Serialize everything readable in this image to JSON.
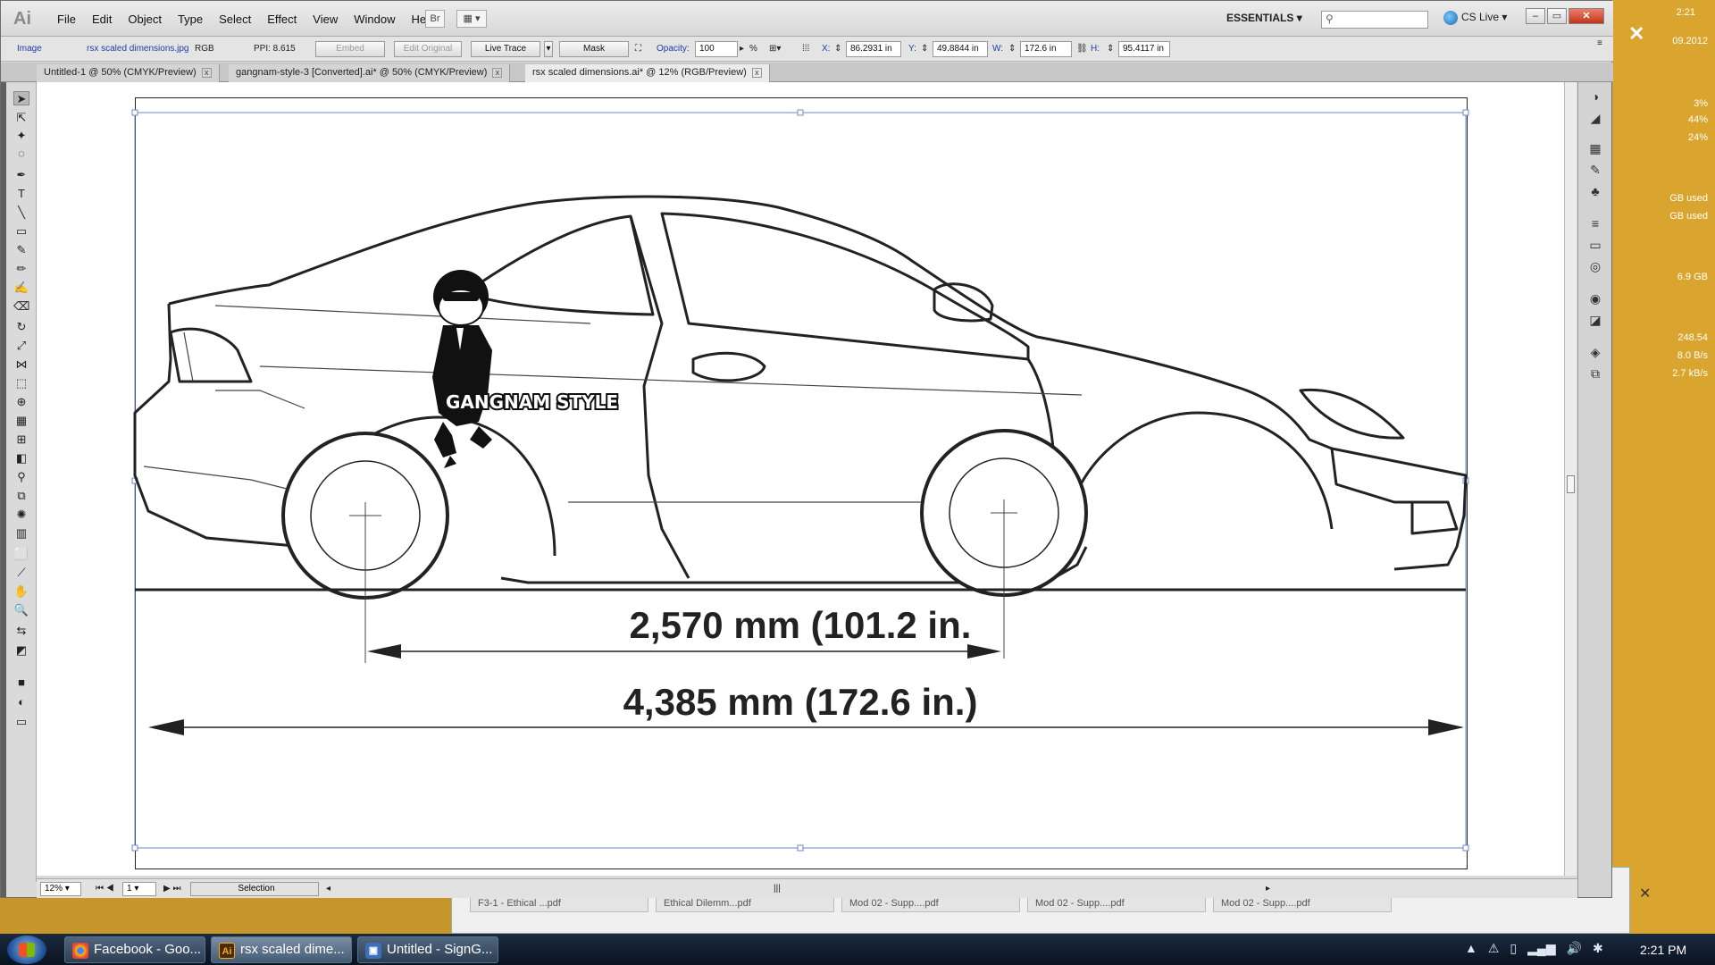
{
  "app": {
    "logo": "Ai",
    "menu": [
      "File",
      "Edit",
      "Object",
      "Type",
      "Select",
      "Effect",
      "View",
      "Window",
      "Help"
    ],
    "bridge_label": "Br",
    "workspace": "ESSENTIALS",
    "cs_live": "CS Live",
    "window_controls": [
      "–",
      "▭",
      "✕"
    ]
  },
  "control": {
    "type_label": "Image",
    "file_name": "rsx scaled dimensions.jpg",
    "color_mode": "RGB",
    "ppi": "PPI: 8.615",
    "embed": "Embed",
    "edit_original": "Edit Original",
    "live_trace": "Live Trace",
    "mask": "Mask",
    "opacity_label": "Opacity:",
    "opacity_value": "100",
    "opacity_unit": "%",
    "x_label": "X:",
    "x_value": "86.2931 in",
    "y_label": "Y:",
    "y_value": "49.8844 in",
    "w_label": "W:",
    "w_value": "172.6 in",
    "h_label": "H:",
    "h_value": "95.4117 in"
  },
  "tabs": [
    {
      "label": "Untitled-1 @ 50% (CMYK/Preview)"
    },
    {
      "label": "gangnam-style-3 [Converted].ai* @ 50% (CMYK/Preview)"
    },
    {
      "label": "rsx scaled dimensions.ai* @ 12% (RGB/Preview)"
    }
  ],
  "artwork": {
    "logo_text": "GANGNAM STYLE",
    "wheelbase": "2,570 mm (101.2 in.",
    "length": "4,385 mm (172.6 in.)"
  },
  "status": {
    "zoom": "12%",
    "page": "1",
    "tool": "Selection"
  },
  "background_app": {
    "date_fragment": "09.2012",
    "time_fragment": "2:21",
    "stats": [
      "3%",
      "44%",
      "24%",
      "GB used",
      "GB used",
      "6.9 GB",
      "248.54",
      "8.0 B/s",
      "2.7 kB/s"
    ],
    "back_tabs": [
      "F3-1 - Ethical ...pdf",
      "Ethical Dilemm...pdf",
      "Mod 02 - Supp....pdf",
      "Mod 02 - Supp....pdf",
      "Mod 02 - Supp....pdf"
    ]
  },
  "taskbar": {
    "items": [
      {
        "label": "Facebook - Goo...",
        "icon": "chrome-icon"
      },
      {
        "label": "rsx scaled dime...",
        "icon": "illustrator-icon"
      },
      {
        "label": "Untitled - SignG...",
        "icon": "signgo-icon"
      }
    ],
    "clock": "2:21 PM"
  },
  "colors": {
    "accent_link": "#1d3ea8",
    "close_red": "#c2341a",
    "desktop_yellow": "#d9a52e"
  }
}
